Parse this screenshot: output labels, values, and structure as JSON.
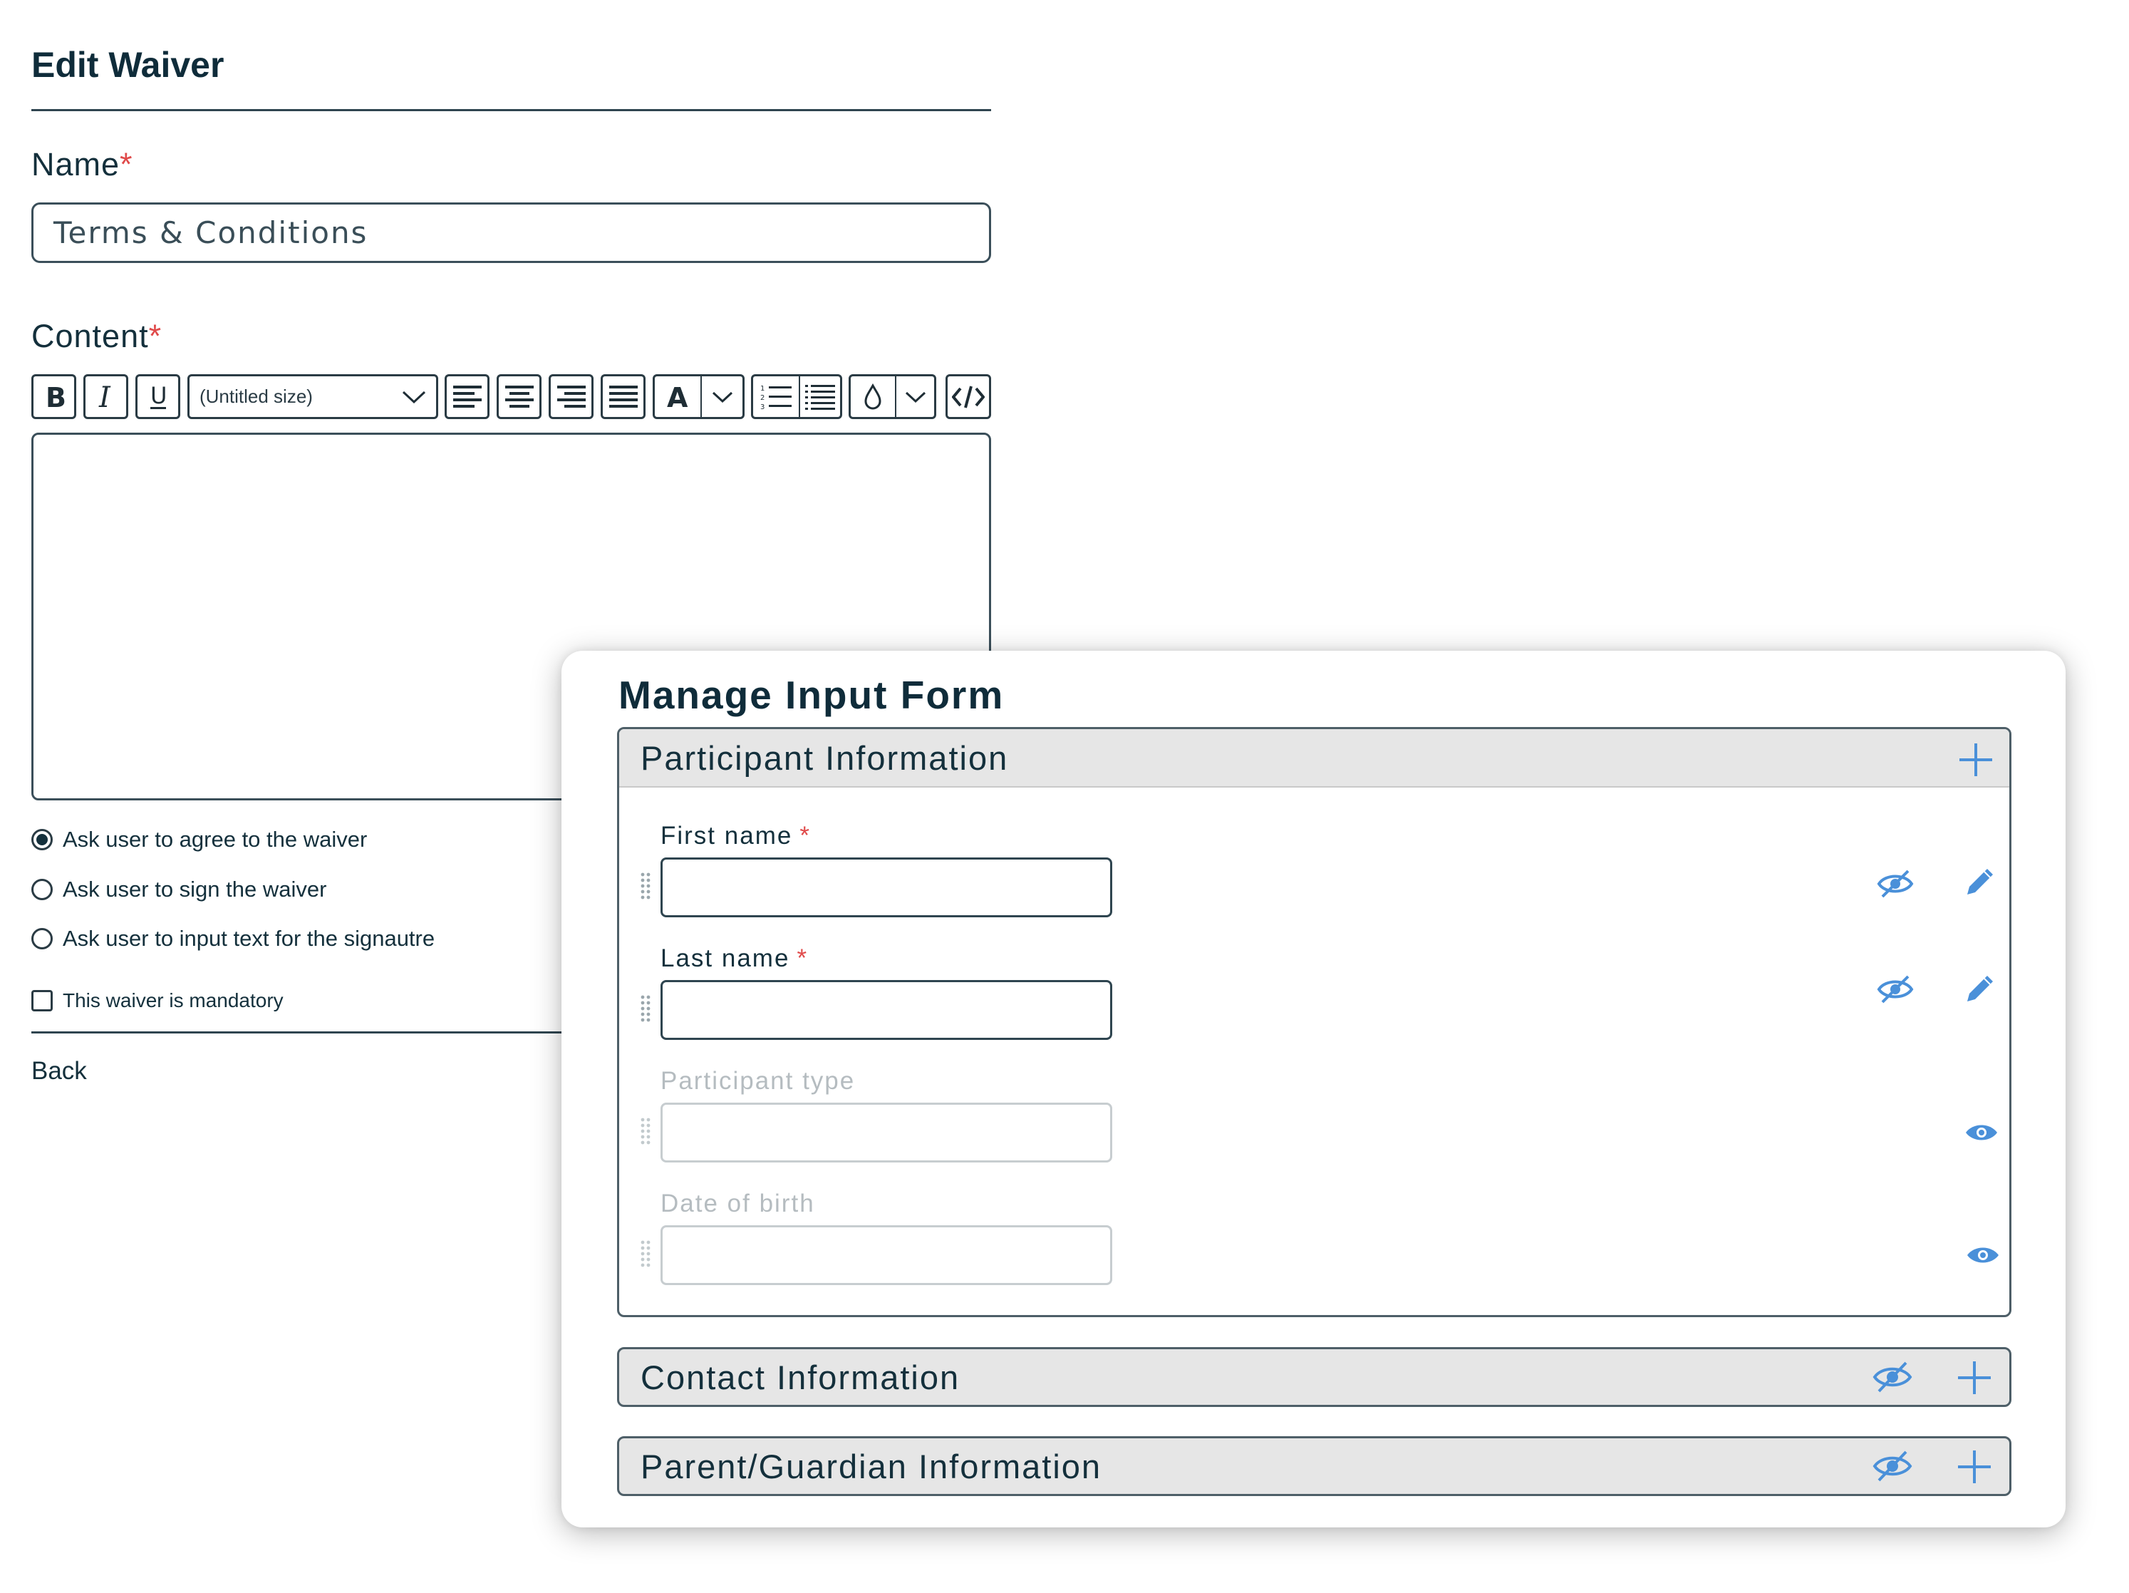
{
  "edit_waiver": {
    "title": "Edit Waiver",
    "name_label": "Name",
    "required_mark": "*",
    "name_value": "Terms & Conditions",
    "content_label": "Content",
    "toolbar": {
      "bold_icon": "bold-icon",
      "italic_icon": "italic-icon",
      "underline_icon": "underline-icon",
      "size_select": "(Untitled size)",
      "align_icons": [
        "align-left-icon",
        "align-center-icon",
        "align-right-icon",
        "align-justify-icon"
      ],
      "font_color_icon": "font-color-icon",
      "list_icons": [
        "ordered-list-icon",
        "unordered-list-icon"
      ],
      "highlight_icon": "highlight-drop-icon",
      "code_icon": "code-view-icon"
    },
    "options": [
      {
        "label": "Ask user to agree to the waiver",
        "selected": true
      },
      {
        "label": "Ask user to sign the waiver",
        "selected": false
      },
      {
        "label": "Ask user to input text for the signautre",
        "selected": false
      }
    ],
    "mandatory_label": "This waiver is mandatory",
    "back_label": "Back"
  },
  "manage_form": {
    "title": "Manage Input Form",
    "sections": [
      {
        "title": "Participant Information",
        "expanded": true,
        "fields": [
          {
            "label": "First name",
            "required": true,
            "visible": true,
            "value": ""
          },
          {
            "label": "Last name",
            "required": true,
            "visible": true,
            "value": ""
          },
          {
            "label": "Participant type",
            "required": false,
            "visible": false,
            "value": ""
          },
          {
            "label": "Date of birth",
            "required": false,
            "visible": false,
            "value": ""
          }
        ]
      },
      {
        "title": "Contact Information",
        "expanded": false
      },
      {
        "title": "Parent/Guardian Information",
        "expanded": false
      }
    ],
    "colors": {
      "accent": "#4a90d9",
      "text": "#14303c",
      "muted_text": "#b5bcc0",
      "required": "#e04a4a",
      "header_bg": "#e6e6e6"
    }
  }
}
